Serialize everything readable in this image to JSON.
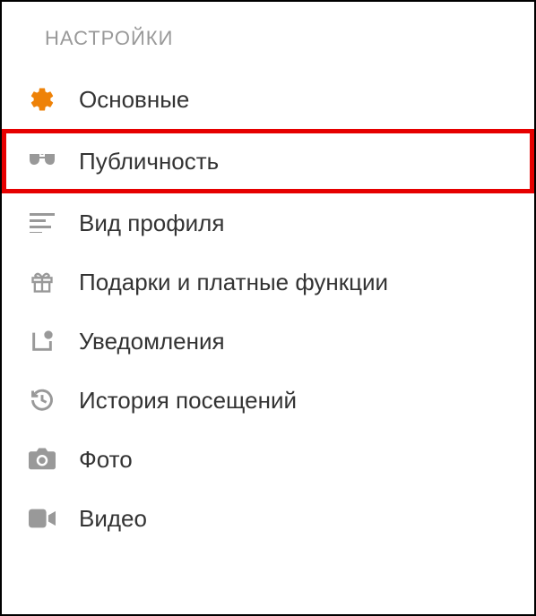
{
  "header": {
    "title": "НАСТРОЙКИ"
  },
  "menu": {
    "items": [
      {
        "label": "Основные"
      },
      {
        "label": "Публичность"
      },
      {
        "label": "Вид профиля"
      },
      {
        "label": "Подарки и платные функции"
      },
      {
        "label": "Уведомления"
      },
      {
        "label": "История посещений"
      },
      {
        "label": "Фото"
      },
      {
        "label": "Видео"
      }
    ]
  }
}
